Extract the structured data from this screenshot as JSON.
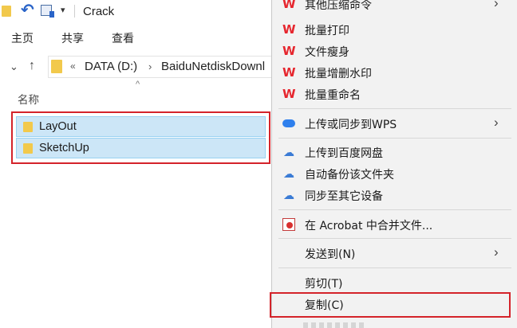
{
  "window": {
    "title": "Crack",
    "quick_access": [
      "folder-icon",
      "undo-icon",
      "properties-icon",
      "dropdown-icon"
    ]
  },
  "ribbon": {
    "tabs": [
      "主页",
      "共享",
      "查看"
    ]
  },
  "address": {
    "overflow": "«",
    "crumbs": [
      "DATA (D:)",
      "BaiduNetdiskDownl"
    ]
  },
  "file_list": {
    "column_header": "名称",
    "items": [
      {
        "name": "LayOut",
        "icon": "folder-icon",
        "selected": true
      },
      {
        "name": "SketchUp",
        "icon": "folder-icon",
        "selected": true
      }
    ]
  },
  "context_menu": {
    "items": [
      {
        "label": "其他压缩命令",
        "icon": "wps-icon",
        "submenu": true
      },
      {
        "label": "批量打印",
        "icon": "wps-icon"
      },
      {
        "label": "文件瘦身",
        "icon": "wps-icon"
      },
      {
        "label": "批量增删水印",
        "icon": "wps-icon"
      },
      {
        "label": "批量重命名",
        "icon": "wps-icon"
      },
      {
        "label": "上传或同步到WPS",
        "icon": "cloud-icon",
        "submenu": true
      },
      {
        "label": "上传到百度网盘",
        "icon": "baidu-netdisk-icon"
      },
      {
        "label": "自动备份该文件夹",
        "icon": "baidu-netdisk-icon"
      },
      {
        "label": "同步至其它设备",
        "icon": "baidu-netdisk-icon"
      },
      {
        "label": "在 Acrobat 中合并文件...",
        "icon": "acrobat-icon"
      },
      {
        "label": "发送到(N)",
        "submenu": true
      },
      {
        "label": "剪切(T)"
      },
      {
        "label": "复制(C)",
        "highlighted": true
      }
    ]
  },
  "colors": {
    "selection_fill": "#cce6f7",
    "highlight_border": "#d4232a",
    "menu_background": "#f2f2f2"
  }
}
